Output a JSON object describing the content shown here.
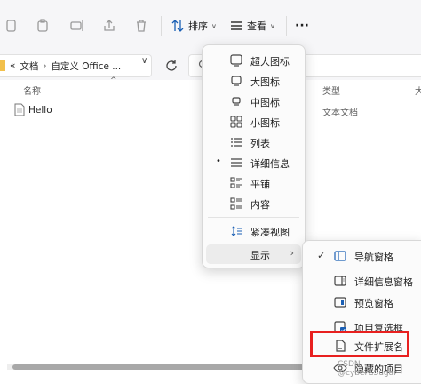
{
  "toolbar": {
    "sort_label": "排序",
    "view_label": "查看",
    "more_label": "···"
  },
  "address": {
    "overflow": "«",
    "crumb1": "文档",
    "separator": "›",
    "crumb2": "自定义 Office ...",
    "chevron": "∨"
  },
  "columns": {
    "name": "名称",
    "type": "类型",
    "size": "大"
  },
  "files": [
    {
      "name": "Hello",
      "type": "文本文档"
    }
  ],
  "view_menu": {
    "items": [
      {
        "label": "超大图标",
        "icon": "extra-large-icons-icon"
      },
      {
        "label": "大图标",
        "icon": "large-icons-icon"
      },
      {
        "label": "中图标",
        "icon": "medium-icons-icon"
      },
      {
        "label": "小图标",
        "icon": "small-icons-icon"
      },
      {
        "label": "列表",
        "icon": "list-icon"
      },
      {
        "label": "详细信息",
        "icon": "details-icon",
        "selected": true,
        "marker": "•"
      },
      {
        "label": "平铺",
        "icon": "tiles-icon"
      },
      {
        "label": "内容",
        "icon": "content-icon"
      },
      {
        "label": "紧凑视图",
        "icon": "compact-view-icon"
      }
    ],
    "show": {
      "label": "显示",
      "arrow": "›"
    }
  },
  "show_submenu": {
    "items": [
      {
        "label": "导航窗格",
        "icon": "navigation-pane-icon",
        "checked": true,
        "check": "✓"
      },
      {
        "label": "详细信息窗格",
        "icon": "details-pane-icon"
      },
      {
        "label": "预览窗格",
        "icon": "preview-pane-icon"
      },
      {
        "label": "项目复选框",
        "icon": "item-checkbox-icon"
      },
      {
        "label": "文件扩展名",
        "icon": "file-extension-icon"
      },
      {
        "label": "隐藏的项目",
        "icon": "hidden-items-icon"
      }
    ]
  },
  "watermark": "CSDN @cyberCSugar",
  "colors": {
    "accent": "#1a5fb4",
    "highlight": "#e8201f",
    "folder": "#f2c04b"
  }
}
